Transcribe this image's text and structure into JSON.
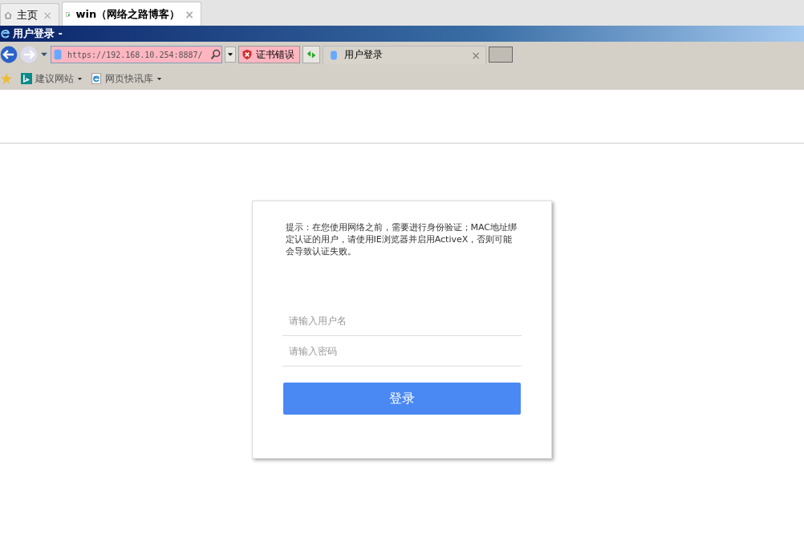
{
  "tabs": [
    {
      "label": "主页",
      "close": "×",
      "selected": false
    },
    {
      "label": "win（网络之路博客）",
      "close": "×",
      "selected": true
    }
  ],
  "window": {
    "title": "用户登录 -"
  },
  "address_bar": {
    "url": "https://192.168.10.254:8887/",
    "cert_error": "证书错误",
    "page_tab": "用户登录",
    "page_tab_close": "×"
  },
  "favorites": [
    {
      "label": "建议网站"
    },
    {
      "label": "网页快讯库"
    }
  ],
  "login": {
    "notice": "提示：在您使用网络之前，需要进行身份验证；MAC地址绑定认证的用户，请使用IE浏览器并启用ActiveX，否则可能会导致认证失败。",
    "username_placeholder": "请输入用户名",
    "password_placeholder": "请输入密码",
    "submit": "登录"
  }
}
